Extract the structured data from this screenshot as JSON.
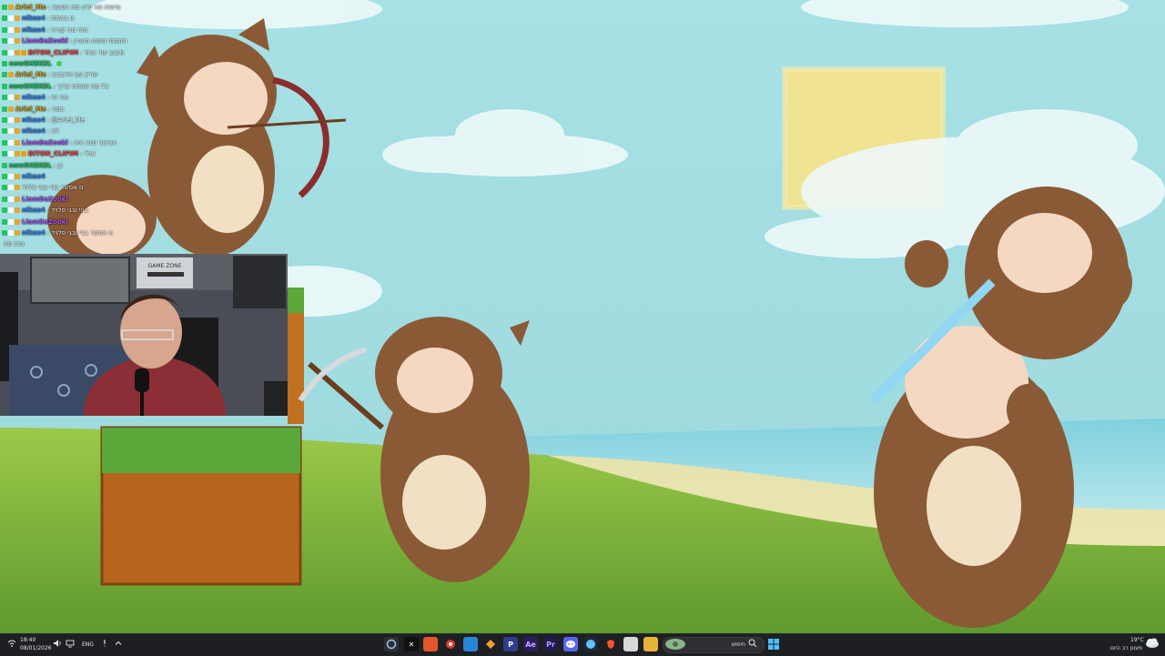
{
  "chat": {
    "lines": [
      {
        "user": "Ariel_Me",
        "color": "#d4a017",
        "msg": "מישהו פה יודע מה השעה",
        "badges": [
          "#22c55e",
          "#e5a52e"
        ]
      },
      {
        "user": "nikas4",
        "color": "#3b82f6",
        "msg": "נו באמת",
        "badges": [
          "#22c55e",
          "#ffffff",
          "#e5a52e"
        ]
      },
      {
        "user": "nikas4",
        "color": "#3b82f6",
        "msg": "אחי מה קורה",
        "badges": [
          "#22c55e",
          "#ffffff",
          "#e5a52e"
        ]
      },
      {
        "user": "LiamBaZookl",
        "color": "#a855f7",
        "msg": "הזמנתי משהו מעניין",
        "badges": [
          "#22c55e",
          "#ffffff",
          "#e5a52e"
        ]
      },
      {
        "user": "BITON_CLIPIM",
        "color": "#ef4444",
        "msg": "סיבוב עוד אחד",
        "badges": [
          "#22c55e",
          "#ffffff",
          "#e5a52e",
          "#f59e0b"
        ]
      },
      {
        "user": "newSHEKEL",
        "color": "#22c55e",
        "msg": "",
        "badges": [
          "#22c55e"
        ],
        "emote": true
      },
      {
        "user": "Ariel_Me",
        "color": "#d4a017",
        "msg": "שרק עם הדבבים",
        "badges": [
          "#22c55e",
          "#e5a52e"
        ]
      },
      {
        "user": "newSHEKEL",
        "color": "#22c55e",
        "msg": "כל מה שאתה צריך",
        "badges": [
          "#22c55e"
        ]
      },
      {
        "user": "nikas4",
        "color": "#3b82f6",
        "msg": "מה זה",
        "badges": [
          "#22c55e",
          "#ffffff",
          "#e5a52e"
        ]
      },
      {
        "user": "Ariel_Me",
        "color": "#d4a017",
        "msg": "כמה",
        "badges": [
          "#22c55e",
          "#e5a52e"
        ]
      },
      {
        "user": "nikas4",
        "color": "#3b82f6",
        "msg": "@Ariel_Me",
        "badges": [
          "#22c55e",
          "#ffffff",
          "#e5a52e"
        ]
      },
      {
        "user": "nikas4",
        "color": "#3b82f6",
        "msg": "לא",
        "badges": [
          "#22c55e",
          "#ffffff",
          "#e5a52e"
        ]
      },
      {
        "user": "LiamBaZookl",
        "color": "#a855f7",
        "msg": "הכיכור שזה היה",
        "badges": [
          "#22c55e",
          "#ffffff",
          "#e5a52e"
        ]
      },
      {
        "user": "BITON_CLIPIM",
        "color": "#ef4444",
        "msg": "אולי",
        "badges": [
          "#22c55e",
          "#ffffff",
          "#e5a52e",
          "#f59e0b"
        ]
      },
      {
        "user": "newSHEKEL",
        "color": "#22c55e",
        "msg": "כן",
        "badges": [
          "#22c55e"
        ]
      },
      {
        "user": "nikas4",
        "color": "#3b82f6",
        "msg": "",
        "badges": [
          "#22c55e",
          "#ffffff",
          "#e5a52e"
        ]
      },
      {
        "user": "",
        "color": "#3b82f6",
        "msg": "נו אפשר בגיי ובגי פלויד",
        "badges": [
          "#22c55e",
          "#ffffff",
          "#e5a52e"
        ]
      },
      {
        "user": "LiamBaZookl",
        "color": "#a855f7",
        "msg": "",
        "badges": [
          "#22c55e",
          "#ffffff",
          "#e5a52e"
        ]
      },
      {
        "user": "nikas4",
        "color": "#3b82f6",
        "msg": "בגיי ובגי פלויד",
        "badges": [
          "#22c55e",
          "#ffffff",
          "#e5a52e"
        ]
      },
      {
        "user": "LiamBaZookl",
        "color": "#a855f7",
        "msg": "",
        "badges": [
          "#22c55e",
          "#ffffff",
          "#e5a52e"
        ]
      },
      {
        "user": "nikas4",
        "color": "#3b82f6",
        "msg": "נו אפשר בגיי ובגי פלויד",
        "badges": [
          "#22c55e",
          "#ffffff",
          "#e5a52e"
        ]
      },
      {
        "user": "",
        "color": "#ffffff",
        "msg": "גורג פה",
        "badges": []
      }
    ]
  },
  "webcam": {
    "poster_line1": "GAME ZONE"
  },
  "taskbar": {
    "time": "18:40",
    "date": "08/01/2026",
    "language": "ENG",
    "search_placeholder": "חיפוש",
    "temperature": "19°C",
    "weather_desc": "מעונן רב היום"
  }
}
